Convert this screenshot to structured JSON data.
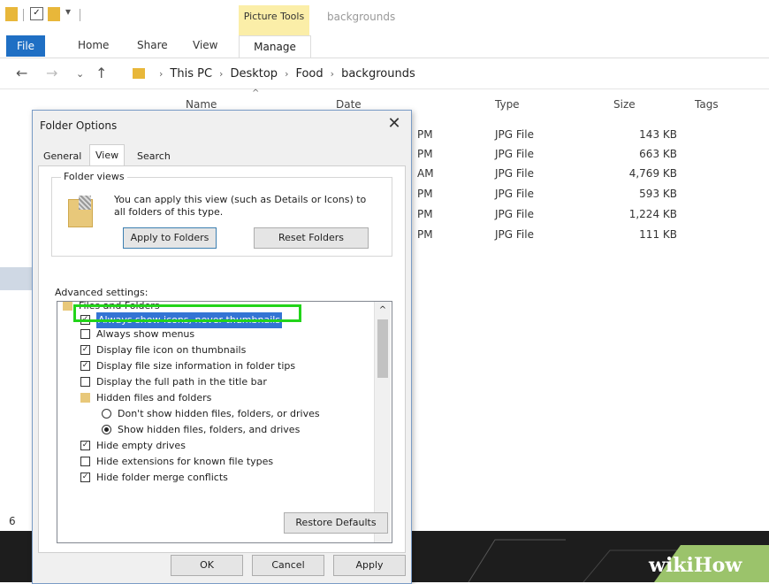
{
  "explorer": {
    "context_tab": "Picture Tools",
    "window_title": "backgrounds",
    "tabs": [
      "File",
      "Home",
      "Share",
      "View",
      "Manage"
    ],
    "path": [
      "This PC",
      "Desktop",
      "Food",
      "backgrounds"
    ],
    "columns": {
      "name": "Name",
      "date": "Date",
      "type": "Type",
      "size": "Size",
      "tags": "Tags"
    },
    "rows": [
      {
        "date": "PM",
        "type": "JPG File",
        "size": "143 KB"
      },
      {
        "date": "PM",
        "type": "JPG File",
        "size": "663 KB"
      },
      {
        "date": "AM",
        "type": "JPG File",
        "size": "4,769 KB"
      },
      {
        "date": "PM",
        "type": "JPG File",
        "size": "593 KB"
      },
      {
        "date": "PM",
        "type": "JPG File",
        "size": "1,224 KB"
      },
      {
        "date": "PM",
        "type": "JPG File",
        "size": "111 KB"
      }
    ],
    "status_count": "6"
  },
  "dialog": {
    "title": "Folder Options",
    "close": "✕",
    "tabs": [
      "General",
      "View",
      "Search"
    ],
    "folder_views": {
      "legend": "Folder views",
      "description": "You can apply this view (such as Details or Icons) to all folders of this type.",
      "apply_button": "Apply to Folders",
      "reset_button": "Reset Folders"
    },
    "advanced_label": "Advanced settings:",
    "items": [
      {
        "kind": "folder",
        "text": "Files and Folders"
      },
      {
        "kind": "checkbox",
        "checked": true,
        "text": "Always show icons, never thumbnails",
        "selected": true
      },
      {
        "kind": "checkbox",
        "checked": false,
        "text": "Always show menus"
      },
      {
        "kind": "checkbox",
        "checked": true,
        "text": "Display file icon on thumbnails"
      },
      {
        "kind": "checkbox",
        "checked": true,
        "text": "Display file size information in folder tips"
      },
      {
        "kind": "checkbox",
        "checked": false,
        "text": "Display the full path in the title bar"
      },
      {
        "kind": "folder",
        "text": "Hidden files and folders"
      },
      {
        "kind": "radio",
        "checked": false,
        "text": "Don't show hidden files, folders, or drives"
      },
      {
        "kind": "radio",
        "checked": true,
        "text": "Show hidden files, folders, and drives"
      },
      {
        "kind": "checkbox",
        "checked": true,
        "text": "Hide empty drives"
      },
      {
        "kind": "checkbox",
        "checked": false,
        "text": "Hide extensions for known file types"
      },
      {
        "kind": "checkbox",
        "checked": true,
        "text": "Hide folder merge conflicts"
      }
    ],
    "restore_button": "Restore Defaults",
    "ok_button": "OK",
    "cancel_button": "Cancel",
    "apply_button": "Apply"
  },
  "watermark": "wikiHow",
  "accent_color": "#1f6fc4",
  "highlight_color": "#22d41a"
}
